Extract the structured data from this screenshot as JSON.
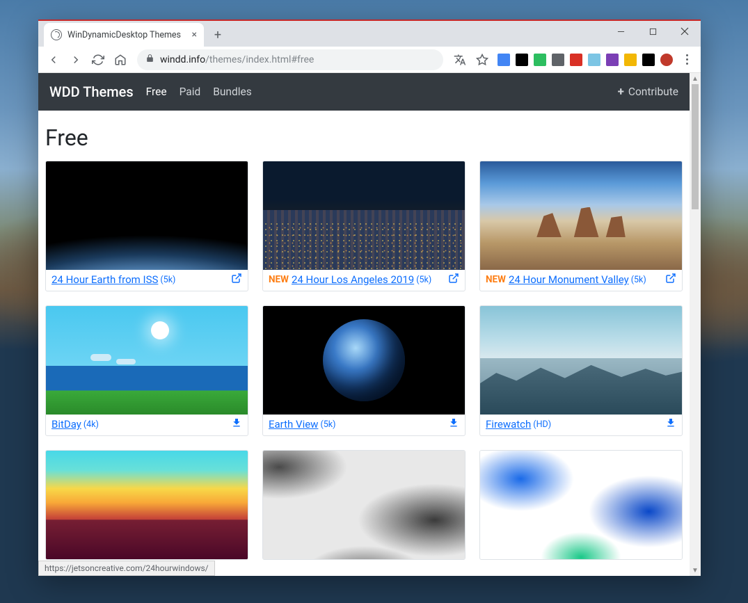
{
  "browser": {
    "tab_title": "WinDynamicDesktop Themes",
    "url_host": "windd.info",
    "url_path": "/themes/index.html#free",
    "status_bar": "https://jetsoncreative.com/24hourwindows/"
  },
  "toolbar_ext_colors": [
    "#4285f4",
    "#000",
    "#2dbe60",
    "#5f6368",
    "#d93025",
    "#7cc5e4",
    "#7b3fb5",
    "#f2b705",
    "#000",
    "#c0392b"
  ],
  "site": {
    "brand": "WDD Themes",
    "nav": [
      {
        "label": "Free",
        "active": true
      },
      {
        "label": "Paid",
        "active": false
      },
      {
        "label": "Bundles",
        "active": false
      }
    ],
    "contribute": "Contribute",
    "section_title": "Free"
  },
  "themes": [
    {
      "title": "24 Hour Earth from ISS",
      "res": "(5k)",
      "new": false,
      "action": "external",
      "thumb": "t-earth-iss"
    },
    {
      "title": "24 Hour Los Angeles 2019",
      "res": "(5k)",
      "new": true,
      "action": "external",
      "thumb": "t-la-night"
    },
    {
      "title": "24 Hour Monument Valley",
      "res": "(5k)",
      "new": true,
      "action": "external",
      "thumb": "t-monument"
    },
    {
      "title": "BitDay",
      "res": "(4k)",
      "new": false,
      "action": "download",
      "thumb": "t-bitday"
    },
    {
      "title": "Earth View",
      "res": "(5k)",
      "new": false,
      "action": "download",
      "thumb": "t-earth-view"
    },
    {
      "title": "Firewatch",
      "res": "(HD)",
      "new": false,
      "action": "download",
      "thumb": "t-firewatch"
    },
    {
      "title": "",
      "res": "",
      "new": false,
      "action": "",
      "thumb": "t-firewatch-sunset"
    },
    {
      "title": "",
      "res": "",
      "new": false,
      "action": "",
      "thumb": "t-grey-blobs"
    },
    {
      "title": "",
      "res": "",
      "new": false,
      "action": "",
      "thumb": "t-blue-blobs"
    }
  ],
  "badge_new_label": "NEW"
}
